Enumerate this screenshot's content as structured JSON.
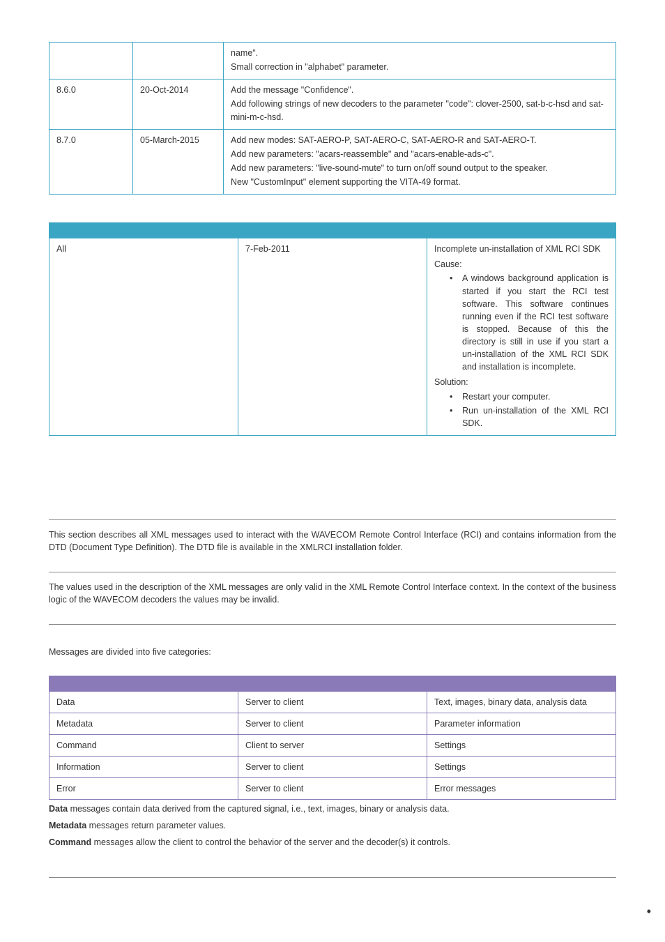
{
  "table1": {
    "rows": [
      {
        "version": "",
        "date": "",
        "desc": [
          "name\".",
          "Small correction in \"alphabet\" parameter."
        ]
      },
      {
        "version": "8.6.0",
        "date": "20-Oct-2014",
        "desc": [
          "Add the message \"Confidence\".",
          "Add following strings of new decoders to the parameter \"code\": clover-2500, sat-b-c-hsd and sat-mini-m-c-hsd."
        ]
      },
      {
        "version": "8.7.0",
        "date": "05-March-2015",
        "desc": [
          "Add new modes: SAT-AERO-P, SAT-AERO-C, SAT-AERO-R and SAT-AERO-T.",
          "Add new parameters: \"acars-reassemble\" and \"acars-enable-ads-c\".",
          "Add new parameters: \"live-sound-mute\" to turn on/off sound output to the speaker.",
          "New \"CustomInput\" element supporting the VITA-49 format."
        ]
      }
    ]
  },
  "table2": {
    "row": {
      "version": "All",
      "date": "7-Feb-2011",
      "issue": "Incomplete un-installation of XML RCI SDK",
      "cause_label": "Cause:",
      "cause_text": "A windows background application is started if you start the RCI test software. This software continues running even if the RCI test software is stopped. Because of this the directory is still in use if you start a un-installation of the XML RCI SDK and installation is incomplete.",
      "solution_label": "Solution:",
      "solution_items": [
        "Restart your computer.",
        "Run un-installation of the XML RCI SDK."
      ]
    }
  },
  "para1": "This section describes all XML messages used to interact with the WAVECOM Remote Control Interface (RCI) and contains information from the DTD (Document Type Definition). The DTD file is available in the XMLRCI installation folder.",
  "para2": "The values used in the description of the XML messages are only valid in the XML Remote Control Interface context. In the context of the business logic of the WAVECOM decoders the values may be invalid.",
  "para3": "Messages are divided into five categories:",
  "table3": {
    "rows": [
      {
        "c1": "Data",
        "c2": "Server to client",
        "c3": "Text, images, binary data, analysis data"
      },
      {
        "c1": "Metadata",
        "c2": "Server to client",
        "c3": "Parameter information"
      },
      {
        "c1": "Command",
        "c2": "Client to server",
        "c3": "Settings"
      },
      {
        "c1": "Information",
        "c2": "Server to client",
        "c3": "Settings"
      },
      {
        "c1": "Error",
        "c2": "Server to client",
        "c3": "Error messages"
      }
    ]
  },
  "closing": {
    "b1": "Data",
    "t1": " messages contain data derived from the captured signal, i.e., text, images, binary or analysis data.",
    "b2": "Metadata",
    "t2": " messages return parameter values.",
    "b3": "Command",
    "t3": " messages allow the client to control the behavior of the server and the decoder(s) it controls."
  }
}
